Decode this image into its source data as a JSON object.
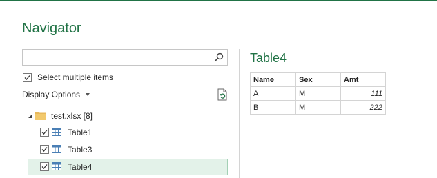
{
  "window": {
    "title": "Navigator",
    "accent_color": "#217346"
  },
  "search": {
    "value": "",
    "placeholder": ""
  },
  "select_multiple": {
    "label": "Select multiple items",
    "checked": true
  },
  "display_options": {
    "label": "Display Options"
  },
  "tree": {
    "file": {
      "label": "test.xlsx [8]",
      "icon": "folder-icon"
    },
    "tables": [
      {
        "label": "Table1",
        "checked": true,
        "selected": false
      },
      {
        "label": "Table3",
        "checked": true,
        "selected": false
      },
      {
        "label": "Table4",
        "checked": true,
        "selected": true
      }
    ]
  },
  "preview": {
    "title": "Table4",
    "columns": [
      "Name",
      "Sex",
      "Amt"
    ],
    "rows": [
      [
        "A",
        "M",
        "111"
      ],
      [
        "B",
        "M",
        "222"
      ]
    ]
  }
}
